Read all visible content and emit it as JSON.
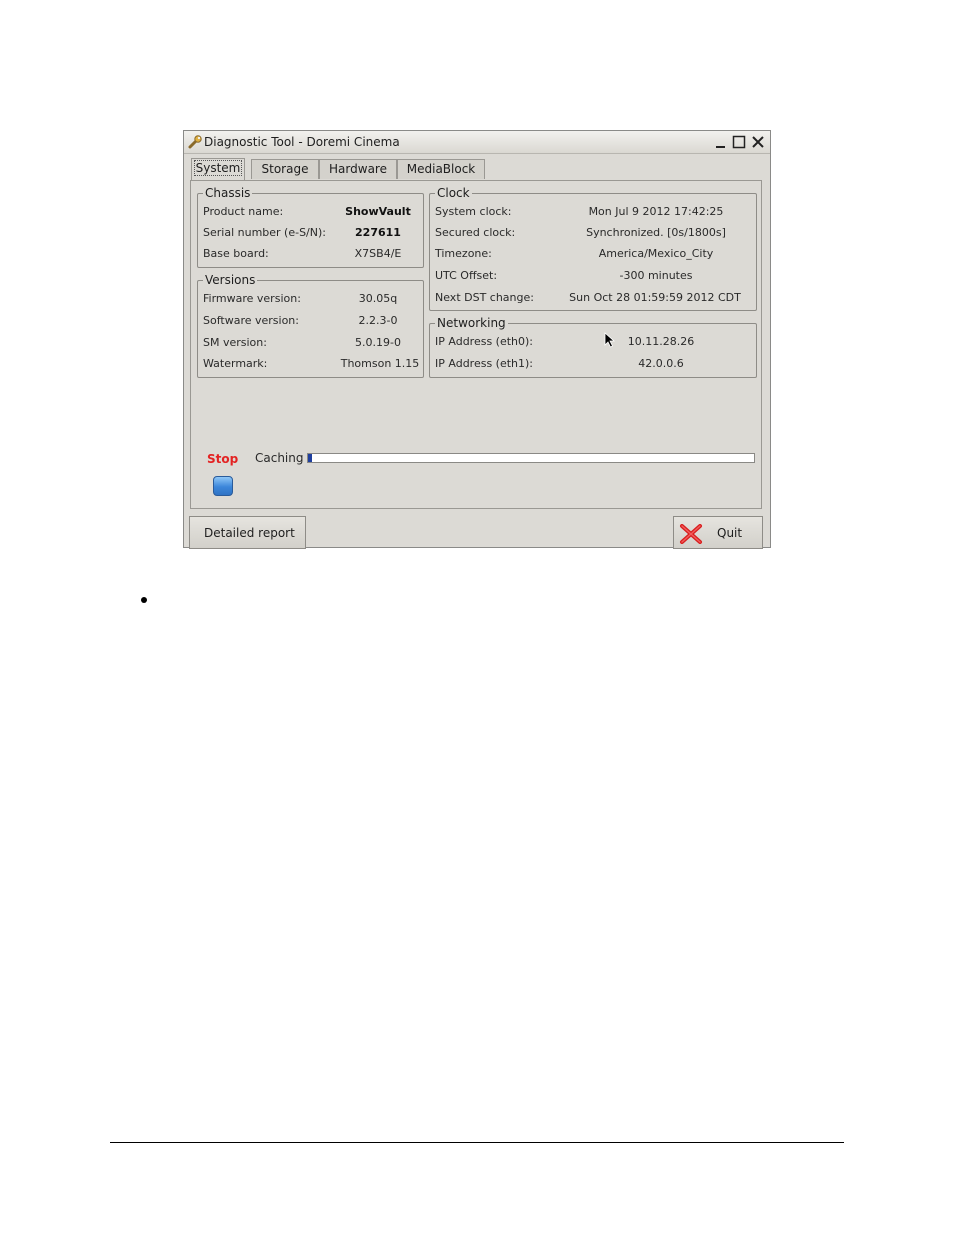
{
  "window": {
    "title": "Diagnostic Tool - Doremi Cinema"
  },
  "tabs": [
    {
      "label": "System",
      "active": true
    },
    {
      "label": "Storage",
      "active": false
    },
    {
      "label": "Hardware",
      "active": false
    },
    {
      "label": "MediaBlock",
      "active": false
    }
  ],
  "chassis": {
    "title": "Chassis",
    "rows": [
      {
        "label": "Product name:",
        "value": "ShowVault"
      },
      {
        "label": "Serial number (e-S/N):",
        "value": "227611"
      },
      {
        "label": "Base board:",
        "value": "X7SB4/E"
      }
    ]
  },
  "versions": {
    "title": "Versions",
    "rows": [
      {
        "label": "Firmware version:",
        "value": "30.05q"
      },
      {
        "label": "Software version:",
        "value": "2.2.3-0"
      },
      {
        "label": "SM version:",
        "value": "5.0.19-0"
      },
      {
        "label": "Watermark:",
        "value": "Thomson 1.15"
      }
    ]
  },
  "clock": {
    "title": "Clock",
    "rows": [
      {
        "label": "System clock:",
        "value": "Mon Jul 9 2012 17:42:25"
      },
      {
        "label": "Secured clock:",
        "value": "Synchronized.  [0s/1800s]"
      },
      {
        "label": "Timezone:",
        "value": "America/Mexico_City"
      },
      {
        "label": "UTC Offset:",
        "value": "-300 minutes"
      },
      {
        "label": "Next DST change:",
        "value": "Sun Oct 28 01:59:59 2012 CDT"
      }
    ]
  },
  "networking": {
    "title": "Networking",
    "rows": [
      {
        "label": "IP Address (eth0):",
        "value": "10.11.28.26"
      },
      {
        "label": "IP Address (eth1):",
        "value": "42.0.0.6"
      }
    ]
  },
  "progress": {
    "stop_label": "Stop",
    "caching_label": "Caching",
    "caching_fraction": 0.01,
    "bar_color": "#1f3f9e"
  },
  "buttons": {
    "report_label": "Detailed report",
    "quit_label": "Quit"
  },
  "icons": {
    "app": "wrench-icon",
    "stop": "stop-button-icon",
    "quit": "red-x-icon",
    "cursor": "mouse-pointer-icon"
  },
  "colors": {
    "stop_text": "#e32323",
    "window_bg": "#dcdad5"
  }
}
